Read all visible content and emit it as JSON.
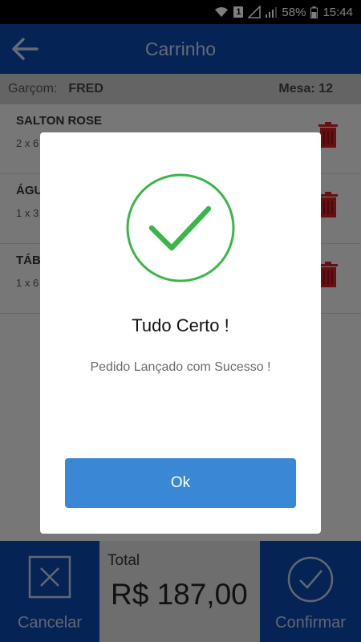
{
  "status_bar": {
    "sim_badge": "1",
    "battery": "58%",
    "time": "15:44"
  },
  "app_bar": {
    "title": "Carrinho"
  },
  "info": {
    "garcom_label": "Garçom:",
    "garcom_name": "FRED",
    "mesa": "Mesa: 12"
  },
  "items": [
    {
      "name": "SALTON ROSE",
      "detail": "2 x 6"
    },
    {
      "name": "ÁGU",
      "detail": "1 x 3"
    },
    {
      "name": "TÁB",
      "detail": "1 x 6"
    }
  ],
  "bottom": {
    "cancel_label": "Cancelar",
    "total_label": "Total",
    "total_value": "R$ 187,00",
    "confirm_label": "Confirmar"
  },
  "dialog": {
    "title": "Tudo Certo !",
    "message": "Pedido Lançado com Sucesso !",
    "ok_label": "Ok"
  },
  "colors": {
    "primary": "#0a47a8",
    "success": "#3cb54a",
    "ok_button": "#3a87d6",
    "trash": "#d01f1f"
  }
}
